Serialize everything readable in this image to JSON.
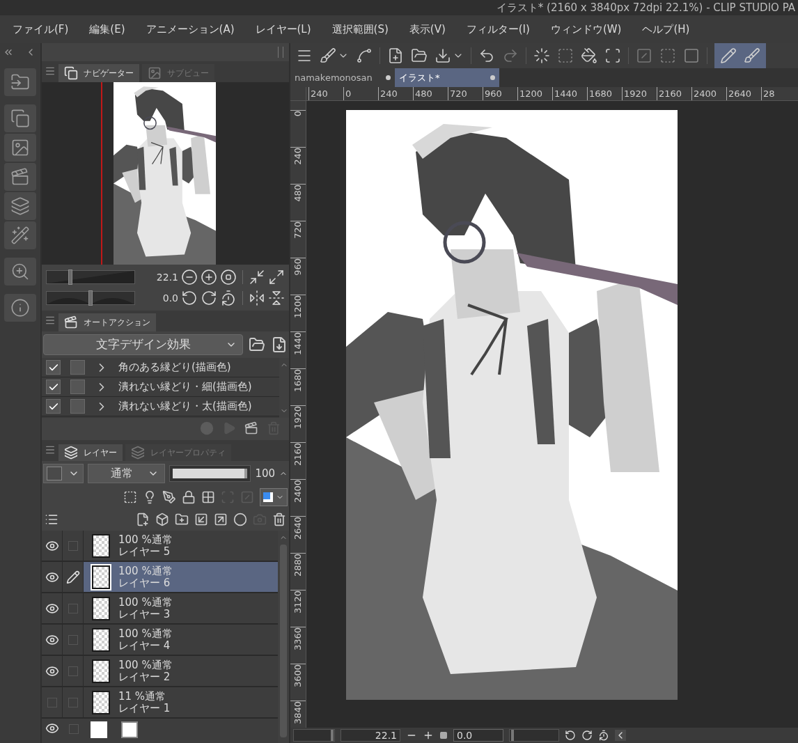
{
  "title_bar": {
    "title": "イラスト* (2160 x 3840px 72dpi 22.1%)  - CLIP STUDIO PA"
  },
  "menu": [
    "ファイル(F)",
    "編集(E)",
    "アニメーション(A)",
    "レイヤー(L)",
    "選択範囲(S)",
    "表示(V)",
    "フィルター(I)",
    "ウィンドウ(W)",
    "ヘルプ(H)"
  ],
  "navigator": {
    "tabs": [
      {
        "label": "ナビゲーター",
        "selected": true
      },
      {
        "label": "サブビュー",
        "selected": false
      }
    ],
    "zoom": {
      "value": "22.1",
      "level": 0.27
    },
    "rotation": {
      "value": "0.0",
      "level": 0.5
    }
  },
  "auto_action": {
    "tab": "オートアクション",
    "set": "文字デザイン効果",
    "items": [
      {
        "label": "角のある縁どり(描画色)",
        "checked": true,
        "dialog": false
      },
      {
        "label": "潰れない縁どり・細(描画色)",
        "checked": true,
        "dialog": false
      },
      {
        "label": "潰れない縁どり・太(描画色)",
        "checked": true,
        "dialog": false
      }
    ]
  },
  "layers": {
    "tabs": [
      {
        "label": "レイヤー",
        "selected": true
      },
      {
        "label": "レイヤープロパティ",
        "selected": false
      }
    ],
    "blend_mode": "通常",
    "opacity": {
      "value": "100",
      "level": 1
    },
    "items": [
      {
        "info": "100 %通常",
        "name": "レイヤー 5",
        "visible": true,
        "editing": false,
        "selected": false
      },
      {
        "info": "100 %通常",
        "name": "レイヤー 6",
        "visible": true,
        "editing": true,
        "selected": true
      },
      {
        "info": "100 %通常",
        "name": "レイヤー 3",
        "visible": true,
        "editing": false,
        "selected": false
      },
      {
        "info": "100 %通常",
        "name": "レイヤー 4",
        "visible": true,
        "editing": false,
        "selected": false
      },
      {
        "info": "100 %通常",
        "name": "レイヤー 2",
        "visible": true,
        "editing": false,
        "selected": false
      },
      {
        "info": "11 %通常",
        "name": "レイヤー 1",
        "visible": false,
        "editing": false,
        "selected": false
      }
    ],
    "paper_layer": {
      "visible": true,
      "editing": false
    }
  },
  "document_tabs": [
    {
      "label": "namakemonosan",
      "selected": false
    },
    {
      "label": "イラスト*",
      "selected": true
    }
  ],
  "ruler": {
    "horizontal": [
      "240",
      "0",
      "240",
      "480",
      "720",
      "960",
      "1200",
      "1440",
      "1680",
      "1920",
      "2160",
      "2400",
      "2640",
      "28"
    ],
    "vertical": [
      "0",
      "240",
      "480",
      "720",
      "960",
      "1200",
      "1440",
      "1680",
      "1920",
      "2160",
      "2400",
      "2640",
      "2880",
      "3120",
      "3360",
      "3600",
      "3840"
    ]
  },
  "bottom_bar": {
    "zoom": "22.1",
    "rotation": "0.0",
    "zoom_slider": {
      "level": 0.95
    },
    "rotation_slider": {
      "level": 0.05
    }
  }
}
